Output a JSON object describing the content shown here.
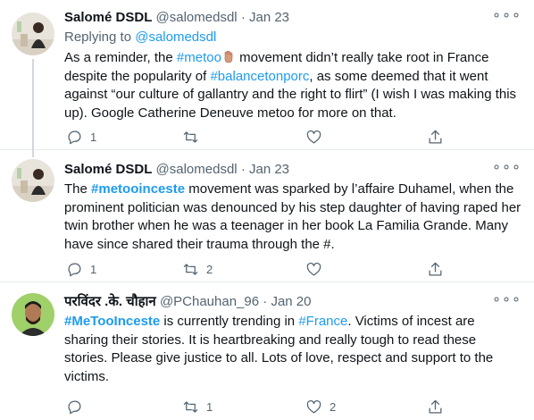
{
  "tweets": [
    {
      "name": "Salomé DSDL",
      "handle": "@salomedsdl",
      "separator": "·",
      "date": "Jan 23",
      "more": "∘∘∘",
      "replying_prefix": "Replying to ",
      "replying_to": "@salomedsdl",
      "body": {
        "p1": "As a reminder, the ",
        "tag1": "#metoo",
        "p2": " movement didn’t really take root in France despite the popularity of ",
        "tag2": "#balancetonporc",
        "p3": ", as some deemed that it went against “our culture of gallantry and the right to flirt” (I wish I was making this up). Google Catherine Deneuve metoo for more on that."
      },
      "reply_count": "1",
      "retweet_count": "",
      "like_count": ""
    },
    {
      "name": "Salomé DSDL",
      "handle": "@salomedsdl",
      "separator": "·",
      "date": "Jan 23",
      "more": "∘∘∘",
      "body": {
        "p1": "The ",
        "tag1": "#metooinceste",
        "p2": " movement was sparked by l’affaire Duhamel, when the prominent politician was denounced by his step daughter of having raped her twin brother when he was a teenager in her book La Familia Grande. Many have since shared their trauma through the #."
      },
      "reply_count": "1",
      "retweet_count": "2",
      "like_count": ""
    },
    {
      "name": "परविंदर .के. चौहान",
      "handle": "@PChauhan_96",
      "separator": "·",
      "date": "Jan 20",
      "more": "∘∘∘",
      "body": {
        "tag1": "#MeTooInceste",
        "p1": " is currently trending in ",
        "tag2": "#France",
        "p2": ". Victims of incest are sharing their stories. It is heartbreaking and really tough to read these stories. Please give justice to all. Lots of love, respect and support to the victims."
      },
      "reply_count": "",
      "retweet_count": "1",
      "like_count": "2"
    }
  ],
  "colors": {
    "link": "#1d9bf0",
    "secondary_text": "#536471",
    "divider": "#e6ecf0"
  },
  "icons": [
    "reply-icon",
    "retweet-icon",
    "like-icon",
    "share-icon",
    "more-icon",
    "raised-hand-emoji"
  ]
}
